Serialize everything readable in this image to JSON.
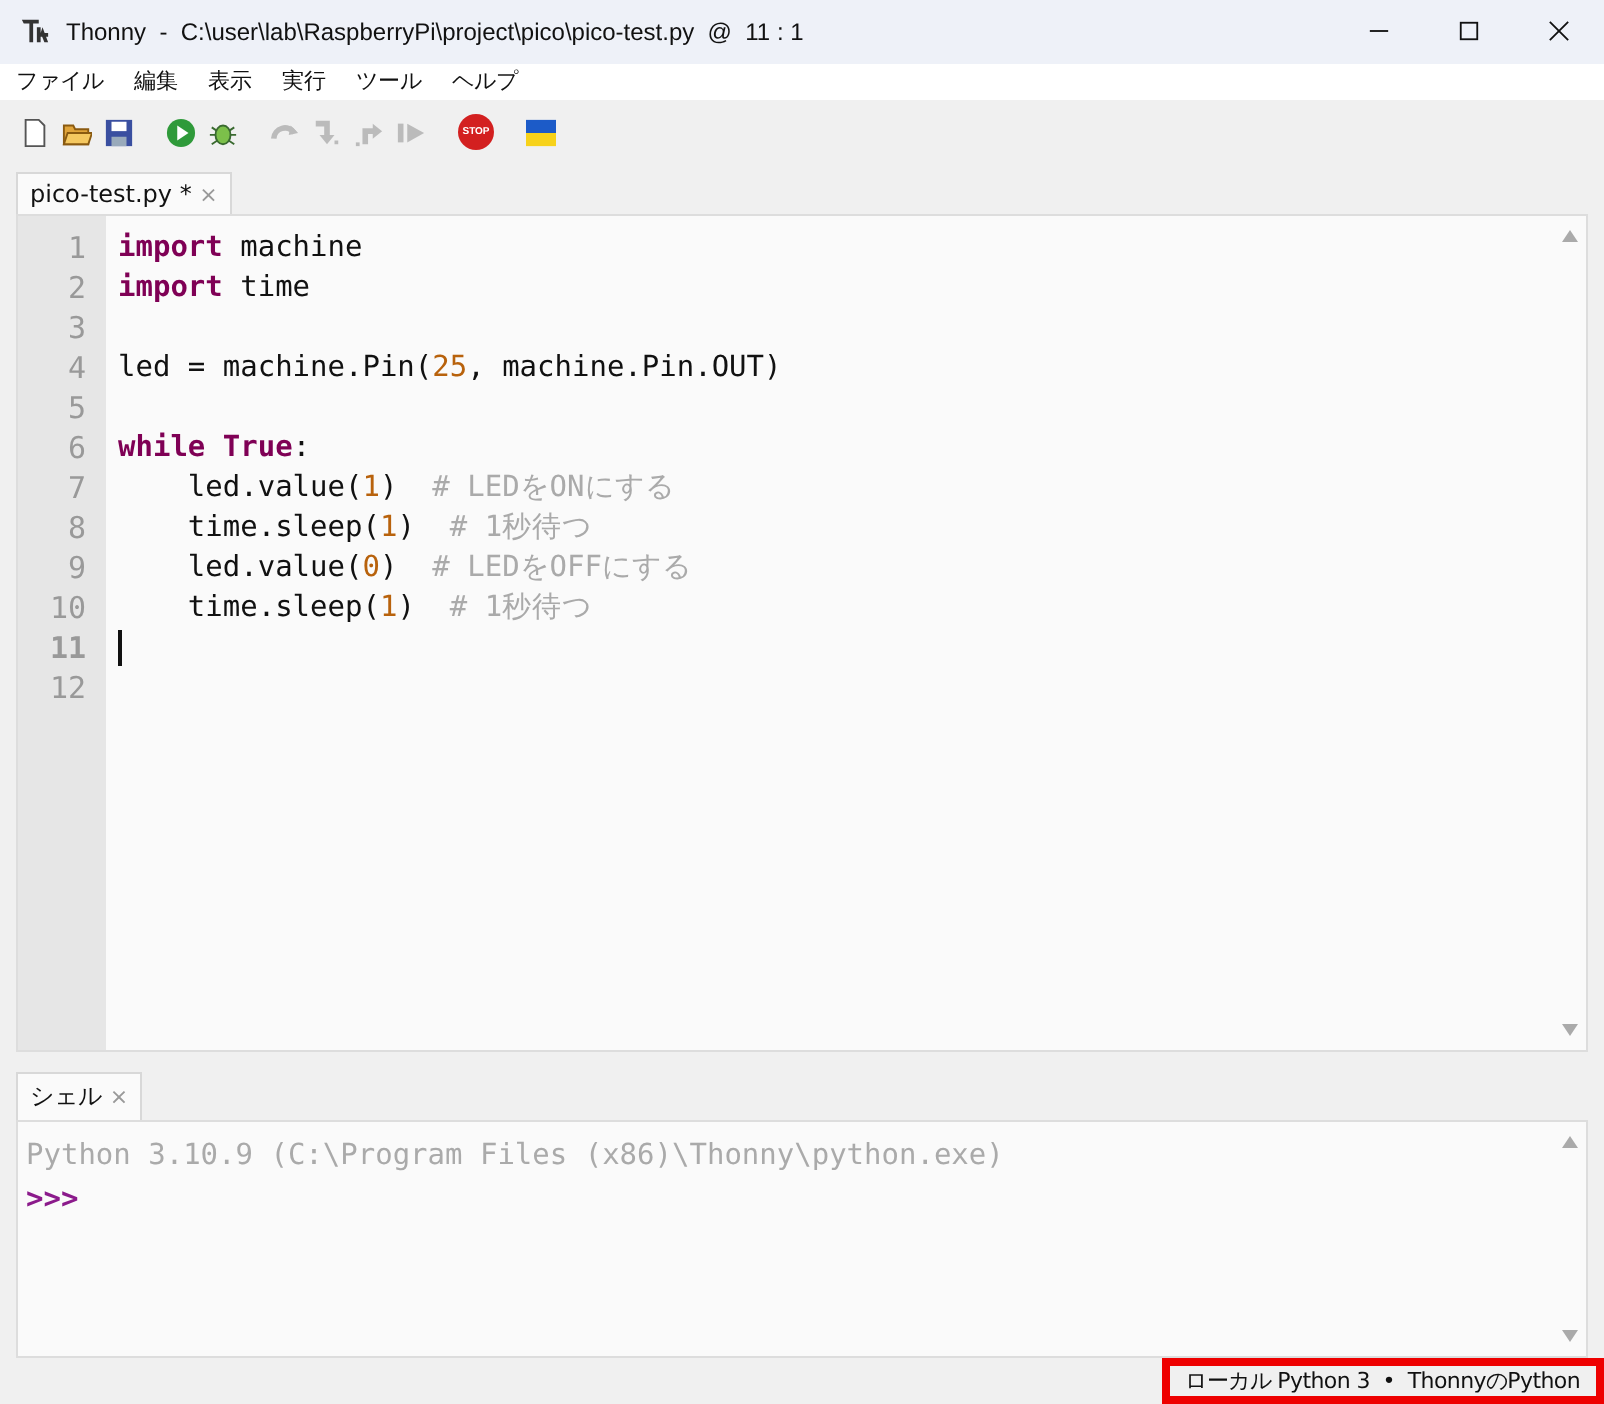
{
  "window": {
    "title": "Thonny  -  C:\\user\\lab\\RaspberryPi\\project\\pico\\pico-test.py  @  11 : 1"
  },
  "menu": [
    "ファイル",
    "編集",
    "表示",
    "実行",
    "ツール",
    "ヘルプ"
  ],
  "toolbar": [
    {
      "kind": "new",
      "disabled": false
    },
    {
      "kind": "open",
      "disabled": false
    },
    {
      "kind": "save",
      "disabled": false
    },
    {
      "kind": "run",
      "disabled": false
    },
    {
      "kind": "debug",
      "disabled": false
    },
    {
      "kind": "step-over",
      "disabled": true
    },
    {
      "kind": "step-into",
      "disabled": true
    },
    {
      "kind": "step-out",
      "disabled": true
    },
    {
      "kind": "resume",
      "disabled": true
    },
    {
      "kind": "stop",
      "disabled": false,
      "label": "STOP"
    },
    {
      "kind": "flag",
      "disabled": false
    }
  ],
  "editor_tabs": [
    {
      "label": "pico-test.py *",
      "close": "×",
      "selected": true
    }
  ],
  "code": [
    {
      "number": "1",
      "current": false,
      "tokens": [
        {
          "kind": "keyword",
          "text": "import"
        },
        {
          "kind": "plain",
          "text": " machine"
        }
      ]
    },
    {
      "number": "2",
      "current": false,
      "tokens": [
        {
          "kind": "keyword",
          "text": "import"
        },
        {
          "kind": "plain",
          "text": " time"
        }
      ]
    },
    {
      "number": "3",
      "current": false
    },
    {
      "number": "4",
      "current": false,
      "tokens": [
        {
          "kind": "plain",
          "text": "led = machine.Pin("
        },
        {
          "kind": "number",
          "text": "25"
        },
        {
          "kind": "plain",
          "text": ", machine.Pin.OUT)"
        }
      ]
    },
    {
      "number": "5",
      "current": false
    },
    {
      "number": "6",
      "current": false,
      "tokens": [
        {
          "kind": "keyword",
          "text": "while True"
        },
        {
          "kind": "plain",
          "text": ":"
        }
      ]
    },
    {
      "number": "7",
      "current": false,
      "tokens": [
        {
          "kind": "plain",
          "text": "    led.value("
        },
        {
          "kind": "number",
          "text": "1"
        },
        {
          "kind": "plain",
          "text": ")  "
        },
        {
          "kind": "comment",
          "text": "# LEDをONにする"
        }
      ]
    },
    {
      "number": "8",
      "current": false,
      "tokens": [
        {
          "kind": "plain",
          "text": "    time.sleep("
        },
        {
          "kind": "number",
          "text": "1"
        },
        {
          "kind": "plain",
          "text": ")  "
        },
        {
          "kind": "comment",
          "text": "# 1秒待つ"
        }
      ]
    },
    {
      "number": "9",
      "current": false,
      "tokens": [
        {
          "kind": "plain",
          "text": "    led.value("
        },
        {
          "kind": "number",
          "text": "0"
        },
        {
          "kind": "plain",
          "text": ")  "
        },
        {
          "kind": "comment",
          "text": "# LEDをOFFにする"
        }
      ]
    },
    {
      "number": "10",
      "current": false,
      "tokens": [
        {
          "kind": "plain",
          "text": "    time.sleep("
        },
        {
          "kind": "number",
          "text": "1"
        },
        {
          "kind": "plain",
          "text": ")  "
        },
        {
          "kind": "comment",
          "text": "# 1秒待つ"
        }
      ]
    },
    {
      "number": "11",
      "current": true
    },
    {
      "number": "12",
      "current": false
    }
  ],
  "shell_tabs": [
    {
      "label": "シェル",
      "close": "×",
      "selected": true
    }
  ],
  "shell": {
    "banner": "Python 3.10.9 (C:\\Program Files (x86)\\Thonny\\python.exe)",
    "prompt": ">>>"
  },
  "status_bar": {
    "interpreter": "ローカル Python 3  •  ThonnyのPython",
    "highlighted": true
  }
}
